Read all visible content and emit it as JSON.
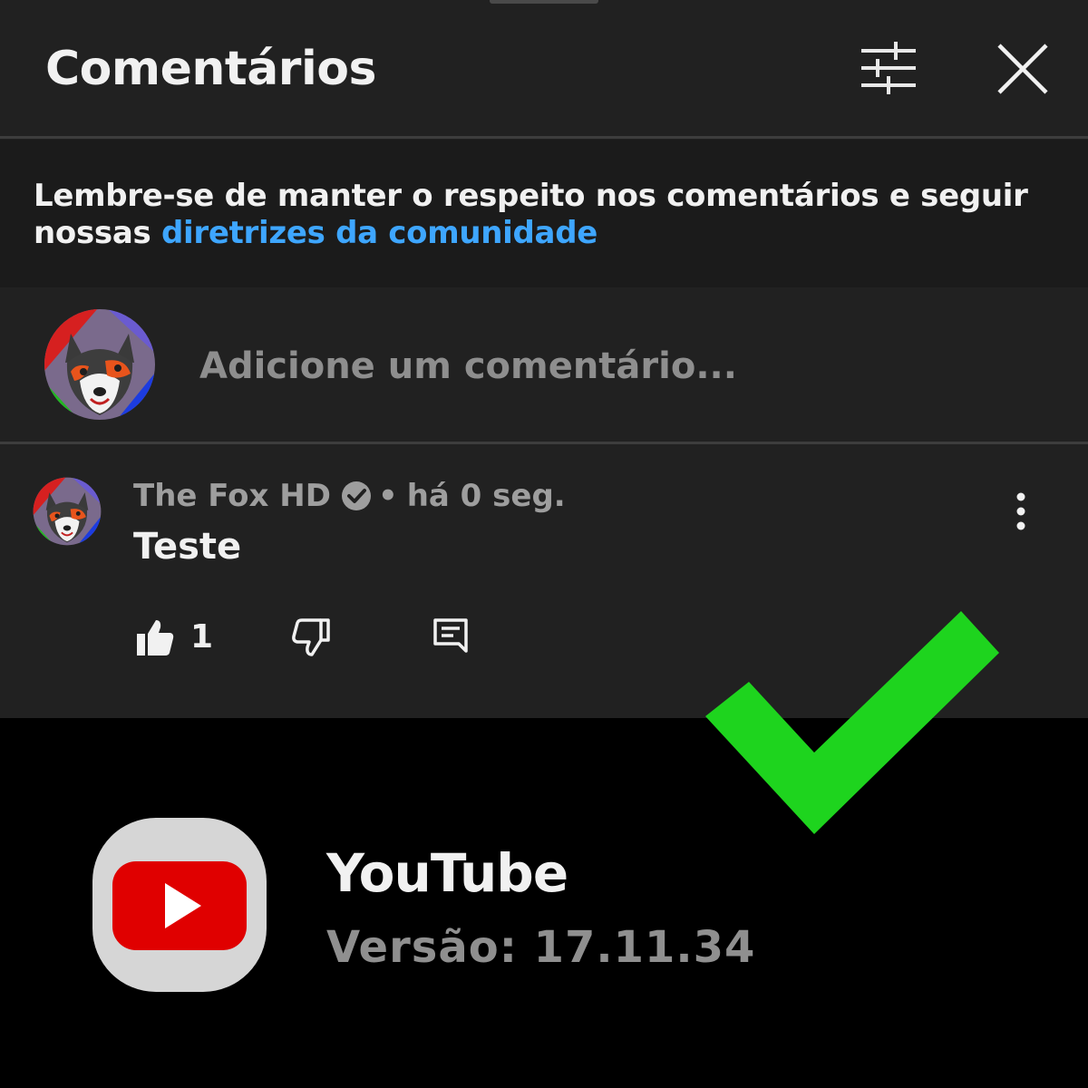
{
  "header": {
    "title": "Comentários",
    "filter_icon": "sliders-icon",
    "close_icon": "close-icon"
  },
  "notice": {
    "text": "Lembre-se de manter o respeito nos comentários e seguir nossas ",
    "link": "diretrizes da comunidade"
  },
  "composer": {
    "placeholder": "Adicione um comentário..."
  },
  "comment": {
    "author": "The Fox HD",
    "verified": true,
    "separator": "•",
    "time": "há 0 seg.",
    "text": "Teste",
    "likes": "1"
  },
  "app_info": {
    "name": "YouTube",
    "version": "Versão: 17.11.34"
  },
  "colors": {
    "panel_bg": "#212121",
    "notice_bg": "#1b1b1b",
    "link": "#3ea6ff",
    "check_green": "#1ed41e",
    "youtube_red": "#e00000"
  }
}
